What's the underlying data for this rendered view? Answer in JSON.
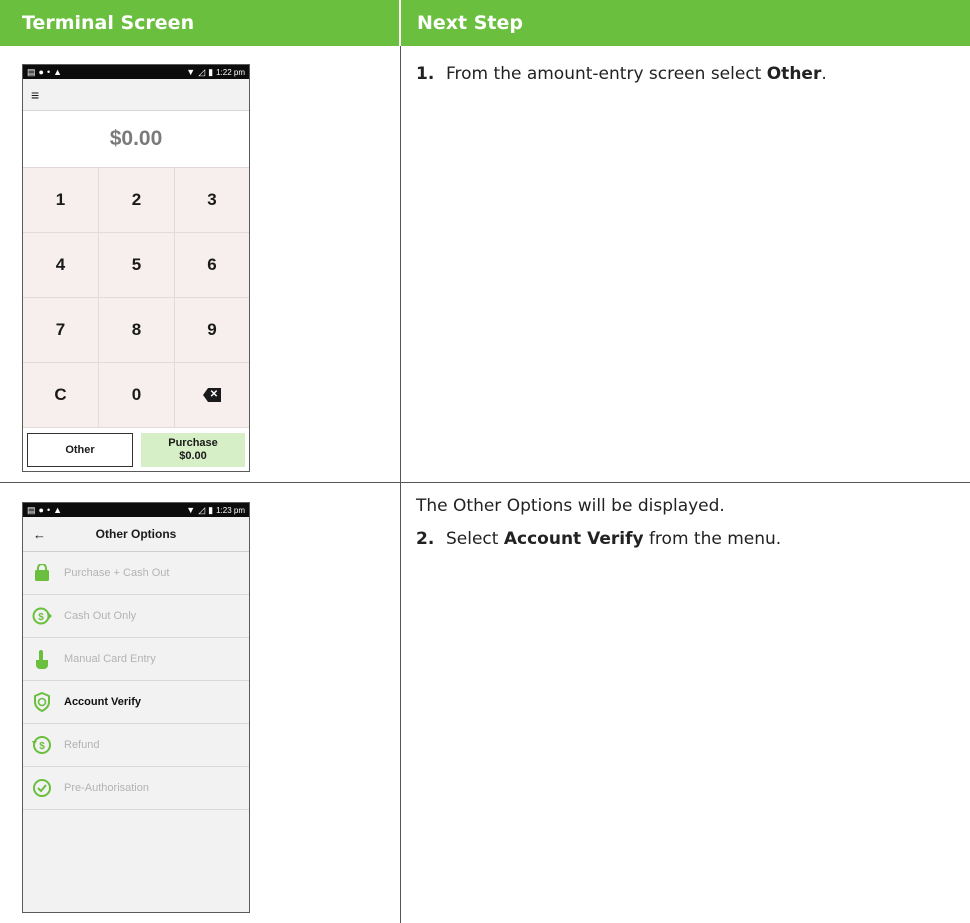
{
  "header": {
    "left": "Terminal Screen",
    "right": "Next Step"
  },
  "phone1": {
    "status_time": "1:22 pm",
    "amount": "$0.00",
    "keys": [
      "1",
      "2",
      "3",
      "4",
      "5",
      "6",
      "7",
      "8",
      "9",
      "C",
      "0",
      "backspace"
    ],
    "other_label": "Other",
    "purchase_label": "Purchase",
    "purchase_amount": "$0.00"
  },
  "phone2": {
    "status_time": "1:23 pm",
    "title": "Other Options",
    "items": [
      {
        "label": "Purchase + Cash Out",
        "icon": "shopping-bag-icon"
      },
      {
        "label": "Cash Out Only",
        "icon": "cash-out-icon"
      },
      {
        "label": "Manual Card Entry",
        "icon": "hand-pointer-icon"
      },
      {
        "label": "Account Verify",
        "icon": "shield-verify-icon"
      },
      {
        "label": "Refund",
        "icon": "refund-icon"
      },
      {
        "label": "Pre-Authorisation",
        "icon": "clock-check-icon"
      }
    ]
  },
  "steps": {
    "s1_num": "1.",
    "s1_pre": "From the amount-entry screen select ",
    "s1_bold": "Other",
    "s1_post": ".",
    "s2_intro": "The Other Options will be displayed.",
    "s2_num": "2.",
    "s2_pre": "Select ",
    "s2_bold": "Account Verify",
    "s2_post": " from the menu."
  },
  "colors": {
    "brand_green": "#6bbf3f",
    "icon_green": "#6bbf3f",
    "purchase_bg": "#d7efc6"
  }
}
